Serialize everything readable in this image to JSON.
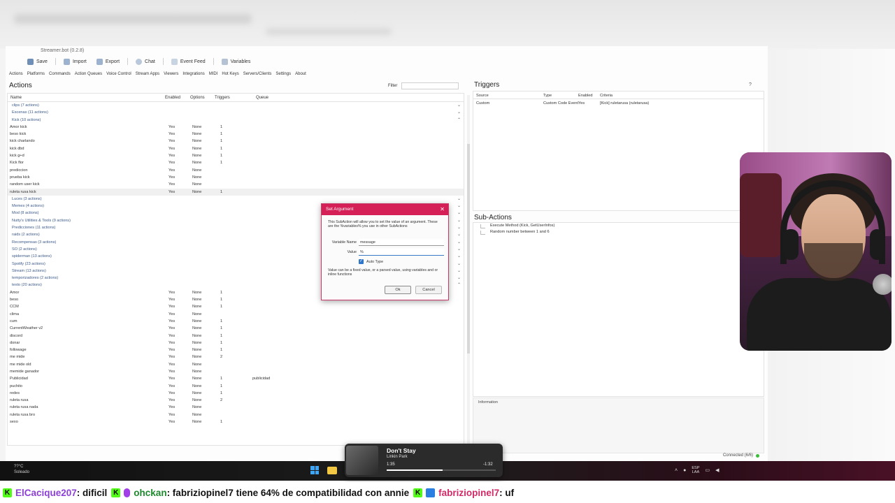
{
  "window": {
    "title": "Streamer.bot (0.2.8)"
  },
  "toolbar": {
    "save": "Save",
    "import": "Import",
    "export": "Export",
    "chat": "Chat",
    "event_feed": "Event Feed",
    "variables": "Variables"
  },
  "menu": [
    "Actions",
    "Platforms",
    "Commands",
    "Action Queues",
    "Voice Control",
    "Stream Apps",
    "Viewers",
    "Integrations",
    "MIDI",
    "Hot Keys",
    "Servers/Clients",
    "Settings",
    "About"
  ],
  "actions": {
    "title": "Actions",
    "filter_label": "Filter",
    "columns": [
      "Name",
      "Enabled",
      "Options",
      "Triggers",
      "Queue"
    ],
    "rows": [
      {
        "type": "group",
        "label": "clips (7 actions)",
        "chev": "⌄"
      },
      {
        "type": "group",
        "label": "Escenas (11 actions)",
        "chev": "⌄"
      },
      {
        "type": "group",
        "label": "Kick (10 actions)",
        "chev": "⌃"
      },
      {
        "type": "item",
        "name": "Amor kick",
        "enabled": "Yes",
        "options": "None",
        "triggers": "1",
        "queue": ""
      },
      {
        "type": "item",
        "name": "beso kick",
        "enabled": "Yes",
        "options": "None",
        "triggers": "1",
        "queue": ""
      },
      {
        "type": "item",
        "name": "kick charlando",
        "enabled": "Yes",
        "options": "None",
        "triggers": "1",
        "queue": ""
      },
      {
        "type": "item",
        "name": "kick dbd",
        "enabled": "Yes",
        "options": "None",
        "triggers": "1",
        "queue": ""
      },
      {
        "type": "item",
        "name": "kick g+d",
        "enabled": "Yes",
        "options": "None",
        "triggers": "1",
        "queue": ""
      },
      {
        "type": "item",
        "name": "Kick flor",
        "enabled": "Yes",
        "options": "None",
        "triggers": "1",
        "queue": ""
      },
      {
        "type": "item",
        "name": "prediccion",
        "enabled": "Yes",
        "options": "None",
        "triggers": "",
        "queue": ""
      },
      {
        "type": "item",
        "name": "prueba kick",
        "enabled": "Yes",
        "options": "None",
        "triggers": "",
        "queue": ""
      },
      {
        "type": "item",
        "name": "random user kick",
        "enabled": "Yes",
        "options": "None",
        "triggers": "",
        "queue": ""
      },
      {
        "type": "item",
        "name": "ruleta rusa kick",
        "enabled": "Yes",
        "options": "None",
        "triggers": "1",
        "queue": "",
        "selected": true
      },
      {
        "type": "group",
        "label": "Luces (3 actions)",
        "chev": "⌄"
      },
      {
        "type": "group",
        "label": "Memes (4 actions)",
        "chev": "⌄"
      },
      {
        "type": "group",
        "label": "Mod (8 actions)",
        "chev": "⌄"
      },
      {
        "type": "group",
        "label": "Nutty's Utilities & Tools (9 actions)",
        "chev": "⌄"
      },
      {
        "type": "group",
        "label": "Predicciones (11 actions)",
        "chev": "⌄"
      },
      {
        "type": "group",
        "label": "raids (2 actions)",
        "chev": "⌄"
      },
      {
        "type": "group",
        "label": "Recompensas (3 actions)",
        "chev": "⌄"
      },
      {
        "type": "group",
        "label": "SO (2 actions)",
        "chev": "⌄"
      },
      {
        "type": "group",
        "label": "spiderman (13 actions)",
        "chev": "⌄"
      },
      {
        "type": "group",
        "label": "Spotify (23 actions)",
        "chev": "⌄"
      },
      {
        "type": "group",
        "label": "Stream (13 actions)",
        "chev": "⌄"
      },
      {
        "type": "group",
        "label": "temporizadores (2 actions)",
        "chev": "⌄"
      },
      {
        "type": "group",
        "label": "texto (20 actions)",
        "chev": "⌃"
      },
      {
        "type": "item",
        "name": "Amor",
        "enabled": "Yes",
        "options": "None",
        "triggers": "1",
        "queue": ""
      },
      {
        "type": "item",
        "name": "beso",
        "enabled": "Yes",
        "options": "None",
        "triggers": "1",
        "queue": ""
      },
      {
        "type": "item",
        "name": "CCM",
        "enabled": "Yes",
        "options": "None",
        "triggers": "1",
        "queue": ""
      },
      {
        "type": "item",
        "name": "clima",
        "enabled": "Yes",
        "options": "None",
        "triggers": "",
        "queue": ""
      },
      {
        "type": "item",
        "name": "cum",
        "enabled": "Yes",
        "options": "None",
        "triggers": "1",
        "queue": ""
      },
      {
        "type": "item",
        "name": "CurrentWeather v2",
        "enabled": "Yes",
        "options": "None",
        "triggers": "1",
        "queue": ""
      },
      {
        "type": "item",
        "name": "discord",
        "enabled": "Yes",
        "options": "None",
        "triggers": "1",
        "queue": ""
      },
      {
        "type": "item",
        "name": "donar",
        "enabled": "Yes",
        "options": "None",
        "triggers": "1",
        "queue": ""
      },
      {
        "type": "item",
        "name": "followage",
        "enabled": "Yes",
        "options": "None",
        "triggers": "1",
        "queue": ""
      },
      {
        "type": "item",
        "name": "me mide",
        "enabled": "Yes",
        "options": "None",
        "triggers": "2",
        "queue": ""
      },
      {
        "type": "item",
        "name": "me mide old",
        "enabled": "Yes",
        "options": "None",
        "triggers": "",
        "queue": ""
      },
      {
        "type": "item",
        "name": "memide ganador",
        "enabled": "Yes",
        "options": "None",
        "triggers": "",
        "queue": ""
      },
      {
        "type": "item",
        "name": "Publicidad",
        "enabled": "Yes",
        "options": "None",
        "triggers": "1",
        "queue": "publicidad"
      },
      {
        "type": "item",
        "name": "puchito",
        "enabled": "Yes",
        "options": "None",
        "triggers": "1",
        "queue": ""
      },
      {
        "type": "item",
        "name": "redes",
        "enabled": "Yes",
        "options": "None",
        "triggers": "1",
        "queue": ""
      },
      {
        "type": "item",
        "name": "ruleta rusa",
        "enabled": "Yes",
        "options": "None",
        "triggers": "2",
        "queue": ""
      },
      {
        "type": "item",
        "name": "ruleta rusa nada",
        "enabled": "Yes",
        "options": "None",
        "triggers": "",
        "queue": ""
      },
      {
        "type": "item",
        "name": "ruleta rusa bro",
        "enabled": "Yes",
        "options": "None",
        "triggers": "",
        "queue": ""
      },
      {
        "type": "item",
        "name": "sexo",
        "enabled": "Yes",
        "options": "None",
        "triggers": "1",
        "queue": ""
      }
    ]
  },
  "triggers": {
    "title": "Triggers",
    "help": "?",
    "columns": [
      "Source",
      "Type",
      "Enabled",
      "Criteria"
    ],
    "rows": [
      {
        "source": "Custom",
        "type": "Custom Code Event",
        "enabled": "Yes",
        "criteria": "[Kick] ruletarusa (ruletarusa)"
      }
    ]
  },
  "subactions": {
    "title": "Sub-Actions",
    "items": [
      "Execute Method (Kick, GetUserInfos)",
      "Random number between 1 and 6"
    ]
  },
  "information": {
    "title": "Information"
  },
  "status": {
    "connected": "Connected (6/6)"
  },
  "dialog": {
    "title": "Set Argument",
    "close": "✕",
    "description": "This SubAction will allow you to set the value of an argument.  These are the %variables% you use in other SubActions",
    "variable_label": "Variable Name",
    "variable_value": "message",
    "value_label": "Value",
    "value_value": "%",
    "auto_type": "Auto Type",
    "note": "Value can be a fixed value, or a parsed value, using variables and or inline functions",
    "ok": "Ok",
    "cancel": "Cancel"
  },
  "media": {
    "song": "Don't Stay",
    "artist": "Linkin Park",
    "elapsed": "1:35",
    "remaining": "-1:32",
    "progress": 0.51
  },
  "taskbar": {
    "left_top": "??°C",
    "left_bottom": "Soleado",
    "lang_top": "ESP",
    "lang_bottom": "LAA"
  },
  "chat": [
    {
      "user": "ElCacique207",
      "message": ": dificil",
      "color": "#8c3fd6"
    },
    {
      "user": "ohckan",
      "message": ": fabriziopinel7 tiene 64% de compatibilidad con annie",
      "color": "#1e8a2e"
    },
    {
      "user": "fabriziopinel7",
      "message": ": uf",
      "color": "#d22a67"
    }
  ],
  "colors": {
    "dialog_accent": "#d41f57",
    "connected": "#3bbd3b",
    "kick_green": "#53fc18"
  }
}
